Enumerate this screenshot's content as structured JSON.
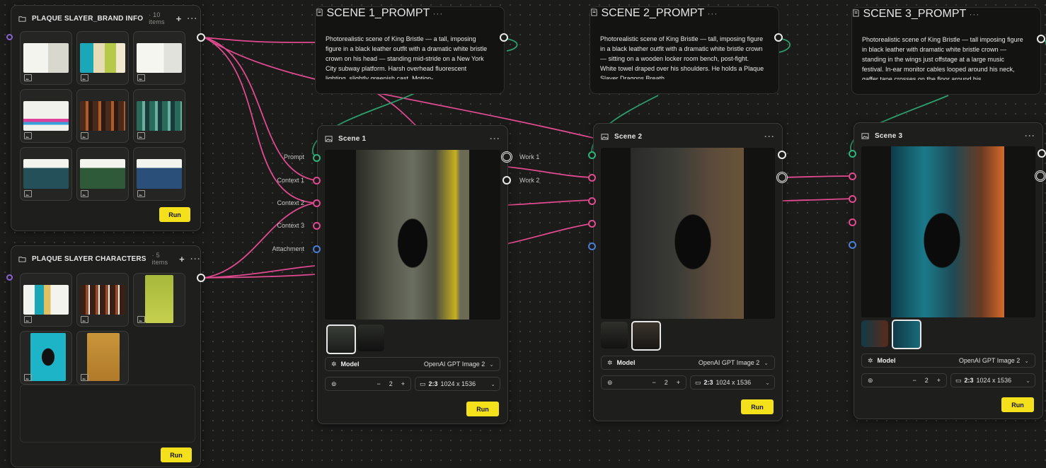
{
  "brand_panel": {
    "title": "PLAQUE SLAYER_BRAND INFO",
    "count": "· 10 items",
    "run_label": "Run"
  },
  "characters_panel": {
    "title": "PLAQUE SLAYER CHARACTERS",
    "count": "· 5 items",
    "run_label": "Run"
  },
  "prompts": [
    {
      "title": "SCENE 1_PROMPT",
      "text": "Photorealistic scene of King Bristle — a tall, imposing figure in a black leather outfit with a dramatic white bristle crown on his head — standing mid-stride on a New York City subway platform. Harsh overhead fluorescent lighting, slightly greenish cast. Motion-"
    },
    {
      "title": "SCENE 2_PROMPT",
      "text": "Photorealistic scene of King Bristle — tall, imposing figure in a black leather outfit with a dramatic white bristle crown — sitting on a wooden locker room bench, post-fight. White towel draped over his shoulders. He holds a Plaque Slayer Dragons Breath"
    },
    {
      "title": "SCENE 3_PROMPT",
      "text": "Photorealistic scene of King Bristle — tall imposing figure in black leather with dramatic white bristle crown — standing in the wings just offstage at a large music festival. In-ear monitor cables looped around his neck, gaffer tape crosses on the floor around his"
    }
  ],
  "scenes": [
    {
      "title": "Scene 1",
      "model_label": "Model",
      "model_value": "OpenAI GPT Image 2",
      "count": "2",
      "minus": "−",
      "plus": "+",
      "ratio": "2:3",
      "size": "1024 x 1536",
      "run_label": "Run"
    },
    {
      "title": "Scene 2",
      "model_label": "Model",
      "model_value": "OpenAI GPT Image 2",
      "count": "2",
      "minus": "−",
      "plus": "+",
      "ratio": "2:3",
      "size": "1024 x 1536",
      "run_label": "Run"
    },
    {
      "title": "Scene 3",
      "model_label": "Model",
      "model_value": "OpenAI GPT Image 2",
      "count": "2",
      "minus": "−",
      "plus": "+",
      "ratio": "2:3",
      "size": "1024 x 1536",
      "run_label": "Run"
    }
  ],
  "input_ports": [
    "Prompt",
    "Context 1",
    "Context 2",
    "Context 3",
    "Attachment"
  ],
  "output_ports": [
    "Work 1",
    "Work 2"
  ],
  "menu_glyph": "···",
  "plus_glyph": "+",
  "colors": {
    "accent": "#f4e11c",
    "wire_pink": "#e04a8f",
    "wire_green": "#2f9e6e",
    "port_green": "#2fb37a",
    "port_blue": "#4a7fd6",
    "port_purple": "#8a63d2"
  }
}
